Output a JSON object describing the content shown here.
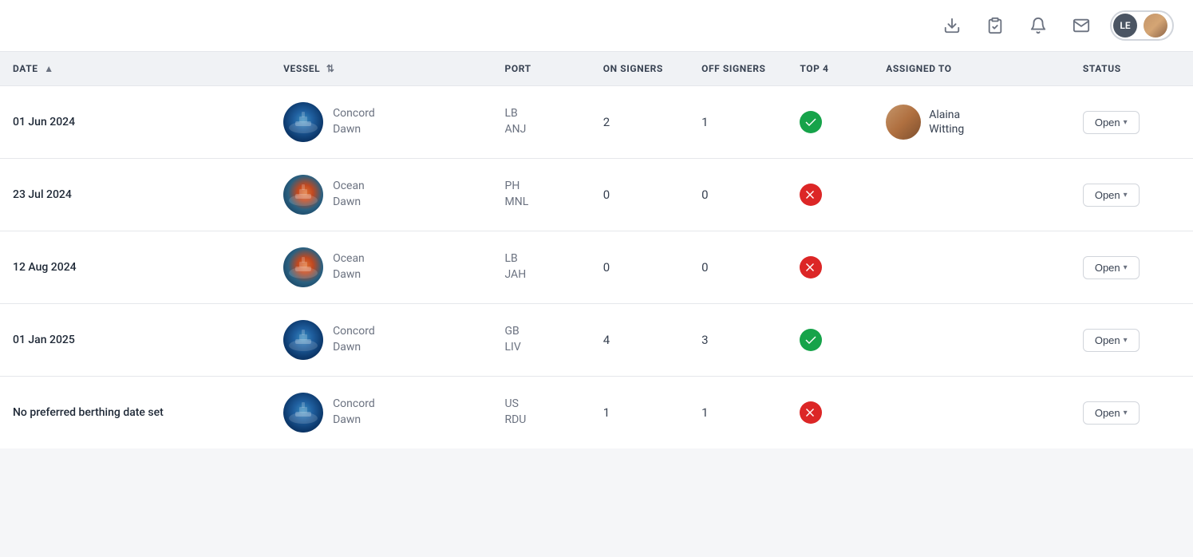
{
  "topbar": {
    "icons": [
      {
        "name": "download-icon",
        "label": "Download"
      },
      {
        "name": "clipboard-icon",
        "label": "Clipboard"
      },
      {
        "name": "bell-icon",
        "label": "Notifications"
      },
      {
        "name": "mail-icon",
        "label": "Mail"
      }
    ],
    "user": {
      "initials": "LE",
      "has_photo": true
    }
  },
  "table": {
    "columns": [
      {
        "key": "date",
        "label": "DATE",
        "sortable": true,
        "sort_direction": "asc"
      },
      {
        "key": "vessel",
        "label": "VESSEL",
        "sortable": true
      },
      {
        "key": "port",
        "label": "PORT"
      },
      {
        "key": "on_signers",
        "label": "ON SIGNERS"
      },
      {
        "key": "off_signers",
        "label": "OFF SIGNERS"
      },
      {
        "key": "top4",
        "label": "TOP 4"
      },
      {
        "key": "assigned_to",
        "label": "ASSIGNED TO"
      },
      {
        "key": "status",
        "label": "STATUS"
      }
    ],
    "rows": [
      {
        "date": "01 Jun 2024",
        "vessel_name": "Concord Dawn",
        "vessel_type": "concord",
        "port_line1": "LB",
        "port_line2": "ANJ",
        "on_signers": "2",
        "off_signers": "1",
        "top4": "green",
        "assigned_name_line1": "Alaina",
        "assigned_name_line2": "Witting",
        "has_assigned": true,
        "status": "Open"
      },
      {
        "date": "23 Jul 2024",
        "vessel_name": "Ocean Dawn",
        "vessel_type": "ocean",
        "port_line1": "PH",
        "port_line2": "MNL",
        "on_signers": "0",
        "off_signers": "0",
        "top4": "red",
        "assigned_name_line1": "",
        "assigned_name_line2": "",
        "has_assigned": false,
        "status": "Open"
      },
      {
        "date": "12 Aug 2024",
        "vessel_name": "Ocean Dawn",
        "vessel_type": "ocean",
        "port_line1": "LB",
        "port_line2": "JAH",
        "on_signers": "0",
        "off_signers": "0",
        "top4": "red",
        "assigned_name_line1": "",
        "assigned_name_line2": "",
        "has_assigned": false,
        "status": "Open"
      },
      {
        "date": "01 Jan 2025",
        "vessel_name": "Concord Dawn",
        "vessel_type": "concord",
        "port_line1": "GB",
        "port_line2": "LIV",
        "on_signers": "4",
        "off_signers": "3",
        "top4": "green",
        "assigned_name_line1": "",
        "assigned_name_line2": "",
        "has_assigned": false,
        "status": "Open"
      },
      {
        "date": "No preferred berthing date set",
        "vessel_name": "Concord Dawn",
        "vessel_type": "concord",
        "port_line1": "US",
        "port_line2": "RDU",
        "on_signers": "1",
        "off_signers": "1",
        "top4": "red",
        "assigned_name_line1": "",
        "assigned_name_line2": "",
        "has_assigned": false,
        "status": "Open"
      }
    ]
  }
}
